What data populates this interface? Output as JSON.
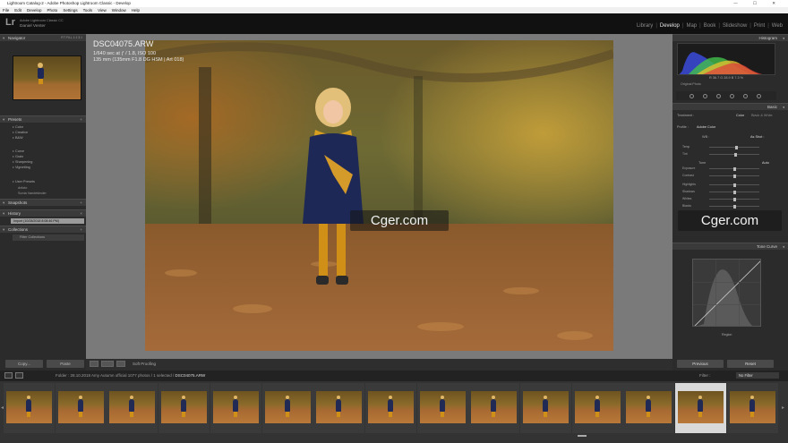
{
  "window": {
    "title": "Lightroom Catalog-2 - Adobe Photoshop Lightroom Classic - Develop",
    "controls": "— ☐ ✕"
  },
  "menu": [
    "File",
    "Edit",
    "Develop",
    "Photo",
    "Settings",
    "Tools",
    "View",
    "Window",
    "Help"
  ],
  "identity": {
    "logo": "Lr",
    "product": "Adobe Lightroom Classic CC",
    "user": "Daniel Venter"
  },
  "modules": [
    "Library",
    "Develop",
    "Map",
    "Book",
    "Slideshow",
    "Print",
    "Web"
  ],
  "module_sep": "|",
  "active_module": "Develop",
  "left_panel": {
    "navigator": {
      "title": "Navigator",
      "zoom": "FIT  FILL  1:1  3:1"
    },
    "presets": {
      "title": "Presets",
      "groups": [
        "Color",
        "Creative",
        "B&W",
        "Curve",
        "Grain",
        "Sharpening",
        "Vignetting",
        "User Presets"
      ],
      "user_items": [
        "dvfoto",
        "Sonia Vandekinder"
      ]
    },
    "snapshots": {
      "title": "Snapshots"
    },
    "history": {
      "title": "History",
      "item": "Import (10/28/2018 8:08:46 PM)"
    },
    "collections": {
      "title": "Collections",
      "item": "Filter Collections"
    },
    "copy": "Copy...",
    "paste": "Paste"
  },
  "photo_info": {
    "filename": "DSC04075.ARW",
    "exif1": "1/640 sec at ƒ / 1.8, ISO 100",
    "exif2": "135 mm (135mm F1.8 DG HSM | Art 018)"
  },
  "watermark": "Cger.com",
  "toolbar": {
    "soft_proofing": "Soft Proofing"
  },
  "right_panel": {
    "histogram": {
      "title": "Histogram",
      "readout": "R  36.7   G  28.9   B  7.3  %",
      "original": "Original Photo"
    },
    "basic": {
      "title": "Basic",
      "treatment_label": "Treatment :",
      "treatment_color": "Color",
      "treatment_bw": "Black & White",
      "profile_label": "Profile :",
      "profile_value": "Adobe Color",
      "wb_label": "WB :",
      "wb_value": "As Shot :",
      "tone_label": "Tone",
      "tone_auto": "Auto",
      "sliders": [
        {
          "label": "Temp",
          "value": 0.55
        },
        {
          "label": "Tint",
          "value": 0.52
        },
        {
          "label": "Exposure",
          "value": 0.5
        },
        {
          "label": "Contrast",
          "value": 0.5
        },
        {
          "label": "Highlights",
          "value": 0.5
        },
        {
          "label": "Shadows",
          "value": 0.5
        },
        {
          "label": "Whites",
          "value": 0.5
        },
        {
          "label": "Blacks",
          "value": 0.5
        }
      ]
    },
    "tone_curve": {
      "title": "Tone Curve",
      "region": "Region"
    },
    "previous": "Previous",
    "reset": "Reset"
  },
  "filmstrip": {
    "folder_prefix": "Folder : 28.10.2018 Amy Autumn official",
    "counts": "1077 photos / 1 selected /",
    "filename": "DSC04075.ARW",
    "filter_label": "Filter :",
    "filter_value": "No Filter",
    "selected_index": 13
  },
  "colors": {
    "accent": "#e8e8e8",
    "panel": "#2b2b2b",
    "center_bg": "#7a7a7a",
    "filmstrip": "#333333"
  }
}
